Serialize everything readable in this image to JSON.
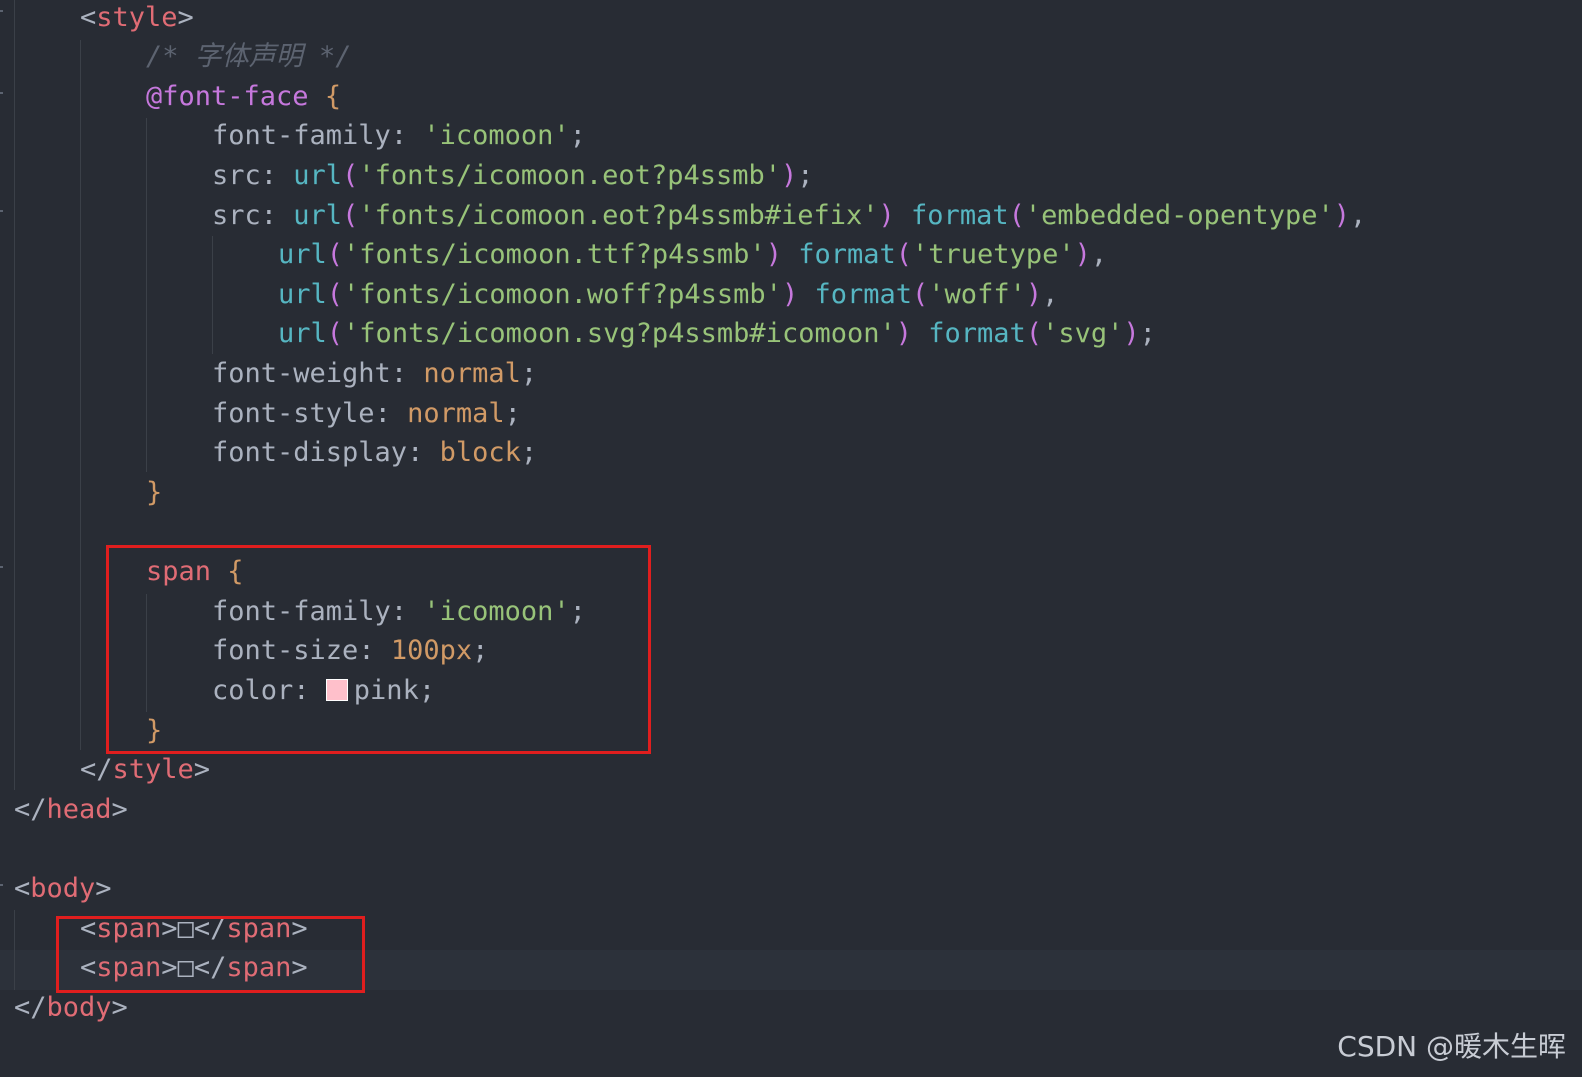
{
  "colors": {
    "background": "#282c34",
    "tag": "#e06c75",
    "punctuation": "#abb2bf",
    "comment": "#5c6370",
    "keyword": "#c678dd",
    "property": "#abb2bf",
    "string": "#98c379",
    "function": "#56b6c2",
    "constant": "#d19a66",
    "highlight_box": "#e01e1e",
    "swatch_pink": "#ffc0cb"
  },
  "code_lines": [
    [
      {
        "t": "<",
        "c": "p"
      },
      {
        "t": "style",
        "c": "tag"
      },
      {
        "t": ">",
        "c": "p"
      }
    ],
    [
      {
        "t": "/* 字体声明 */",
        "c": "comment"
      }
    ],
    [
      {
        "t": "@font-face",
        "c": "keyword"
      },
      {
        "t": " ",
        "c": "p"
      },
      {
        "t": "{",
        "c": "constant"
      }
    ],
    [
      {
        "t": "font-family",
        "c": "property"
      },
      {
        "t": ": ",
        "c": "p"
      },
      {
        "t": "'icomoon'",
        "c": "string"
      },
      {
        "t": ";",
        "c": "p"
      }
    ],
    [
      {
        "t": "src",
        "c": "property"
      },
      {
        "t": ": ",
        "c": "p"
      },
      {
        "t": "url",
        "c": "function"
      },
      {
        "t": "(",
        "c": "keyword"
      },
      {
        "t": "'fonts/icomoon.eot?p4ssmb'",
        "c": "string"
      },
      {
        "t": ")",
        "c": "keyword"
      },
      {
        "t": ";",
        "c": "p"
      }
    ],
    [
      {
        "t": "src",
        "c": "property"
      },
      {
        "t": ": ",
        "c": "p"
      },
      {
        "t": "url",
        "c": "function"
      },
      {
        "t": "(",
        "c": "keyword"
      },
      {
        "t": "'fonts/icomoon.eot?p4ssmb#iefix'",
        "c": "string"
      },
      {
        "t": ")",
        "c": "keyword"
      },
      {
        "t": " ",
        "c": "p"
      },
      {
        "t": "format",
        "c": "function"
      },
      {
        "t": "(",
        "c": "keyword"
      },
      {
        "t": "'embedded-opentype'",
        "c": "string"
      },
      {
        "t": ")",
        "c": "keyword"
      },
      {
        "t": ",",
        "c": "p"
      }
    ],
    [
      {
        "t": "url",
        "c": "function"
      },
      {
        "t": "(",
        "c": "keyword"
      },
      {
        "t": "'fonts/icomoon.ttf?p4ssmb'",
        "c": "string"
      },
      {
        "t": ")",
        "c": "keyword"
      },
      {
        "t": " ",
        "c": "p"
      },
      {
        "t": "format",
        "c": "function"
      },
      {
        "t": "(",
        "c": "keyword"
      },
      {
        "t": "'truetype'",
        "c": "string"
      },
      {
        "t": ")",
        "c": "keyword"
      },
      {
        "t": ",",
        "c": "p"
      }
    ],
    [
      {
        "t": "url",
        "c": "function"
      },
      {
        "t": "(",
        "c": "keyword"
      },
      {
        "t": "'fonts/icomoon.woff?p4ssmb'",
        "c": "string"
      },
      {
        "t": ")",
        "c": "keyword"
      },
      {
        "t": " ",
        "c": "p"
      },
      {
        "t": "format",
        "c": "function"
      },
      {
        "t": "(",
        "c": "keyword"
      },
      {
        "t": "'woff'",
        "c": "string"
      },
      {
        "t": ")",
        "c": "keyword"
      },
      {
        "t": ",",
        "c": "p"
      }
    ],
    [
      {
        "t": "url",
        "c": "function"
      },
      {
        "t": "(",
        "c": "keyword"
      },
      {
        "t": "'fonts/icomoon.svg?p4ssmb#icomoon'",
        "c": "string"
      },
      {
        "t": ")",
        "c": "keyword"
      },
      {
        "t": " ",
        "c": "p"
      },
      {
        "t": "format",
        "c": "function"
      },
      {
        "t": "(",
        "c": "keyword"
      },
      {
        "t": "'svg'",
        "c": "string"
      },
      {
        "t": ")",
        "c": "keyword"
      },
      {
        "t": ";",
        "c": "p"
      }
    ],
    [
      {
        "t": "font-weight",
        "c": "property"
      },
      {
        "t": ": ",
        "c": "p"
      },
      {
        "t": "normal",
        "c": "constant"
      },
      {
        "t": ";",
        "c": "p"
      }
    ],
    [
      {
        "t": "font-style",
        "c": "property"
      },
      {
        "t": ": ",
        "c": "p"
      },
      {
        "t": "normal",
        "c": "constant"
      },
      {
        "t": ";",
        "c": "p"
      }
    ],
    [
      {
        "t": "font-display",
        "c": "property"
      },
      {
        "t": ": ",
        "c": "p"
      },
      {
        "t": "block",
        "c": "constant"
      },
      {
        "t": ";",
        "c": "p"
      }
    ],
    [
      {
        "t": "}",
        "c": "constant"
      }
    ],
    [],
    [
      {
        "t": "span",
        "c": "tag"
      },
      {
        "t": " ",
        "c": "p"
      },
      {
        "t": "{",
        "c": "constant"
      }
    ],
    [
      {
        "t": "font-family",
        "c": "property"
      },
      {
        "t": ": ",
        "c": "p"
      },
      {
        "t": "'icomoon'",
        "c": "string"
      },
      {
        "t": ";",
        "c": "p"
      }
    ],
    [
      {
        "t": "font-size",
        "c": "property"
      },
      {
        "t": ": ",
        "c": "p"
      },
      {
        "t": "100px",
        "c": "constant"
      },
      {
        "t": ";",
        "c": "p"
      }
    ],
    [
      {
        "t": "color",
        "c": "property"
      },
      {
        "t": ": ",
        "c": "p"
      },
      {
        "t": "",
        "c": "swatch"
      },
      {
        "t": "pink",
        "c": "p"
      },
      {
        "t": ";",
        "c": "p"
      }
    ],
    [
      {
        "t": "}",
        "c": "constant"
      }
    ],
    [
      {
        "t": "</",
        "c": "p"
      },
      {
        "t": "style",
        "c": "tag"
      },
      {
        "t": ">",
        "c": "p"
      }
    ],
    [
      {
        "t": "</",
        "c": "p"
      },
      {
        "t": "head",
        "c": "tag"
      },
      {
        "t": ">",
        "c": "p"
      }
    ],
    [],
    [
      {
        "t": "<",
        "c": "p"
      },
      {
        "t": "body",
        "c": "tag"
      },
      {
        "t": ">",
        "c": "p"
      }
    ],
    [
      {
        "t": "<",
        "c": "p"
      },
      {
        "t": "span",
        "c": "tag"
      },
      {
        "t": ">",
        "c": "p"
      },
      {
        "t": "□",
        "c": "p"
      },
      {
        "t": "</",
        "c": "p"
      },
      {
        "t": "span",
        "c": "tag"
      },
      {
        "t": ">",
        "c": "p"
      }
    ],
    [
      {
        "t": "<",
        "c": "p"
      },
      {
        "t": "span",
        "c": "tag"
      },
      {
        "t": ">",
        "c": "p"
      },
      {
        "t": "□",
        "c": "p"
      },
      {
        "t": "</",
        "c": "p"
      },
      {
        "t": "span",
        "c": "tag"
      },
      {
        "t": ">",
        "c": "p"
      }
    ],
    [
      {
        "t": "</",
        "c": "p"
      },
      {
        "t": "body",
        "c": "tag"
      },
      {
        "t": ">",
        "c": "p"
      }
    ]
  ],
  "watermark": "CSDN @暖木生晖"
}
